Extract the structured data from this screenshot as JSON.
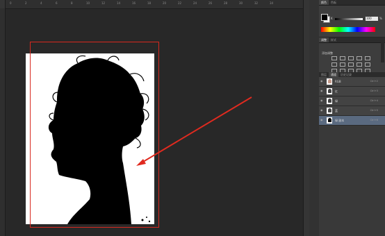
{
  "ruler": {
    "ticks": [
      "0",
      "2",
      "4",
      "6",
      "8",
      "10",
      "12",
      "14",
      "16",
      "18",
      "20",
      "22",
      "24",
      "26",
      "28",
      "30",
      "32",
      "34"
    ]
  },
  "panels": {
    "color_tabs": [
      "颜色",
      "色板"
    ],
    "k_label": "K",
    "k_value": "100",
    "k_unit": "%",
    "adjust_tabs": [
      "调整",
      "样式"
    ],
    "adjust_title": "添加调整"
  },
  "layer_tabs": [
    "图层",
    "通道",
    "历史记录"
  ],
  "channels": [
    {
      "name": "RGB",
      "shortcut": "Ctrl+2"
    },
    {
      "name": "红",
      "shortcut": "Ctrl+3"
    },
    {
      "name": "绿",
      "shortcut": "Ctrl+4"
    },
    {
      "name": "蓝",
      "shortcut": "Ctrl+5"
    },
    {
      "name": "绿 副本",
      "shortcut": "Ctrl+6"
    }
  ],
  "colors": {
    "selection": "#d8281e",
    "arrow": "#e02a1f",
    "selected_layer": "#5a6a80"
  }
}
